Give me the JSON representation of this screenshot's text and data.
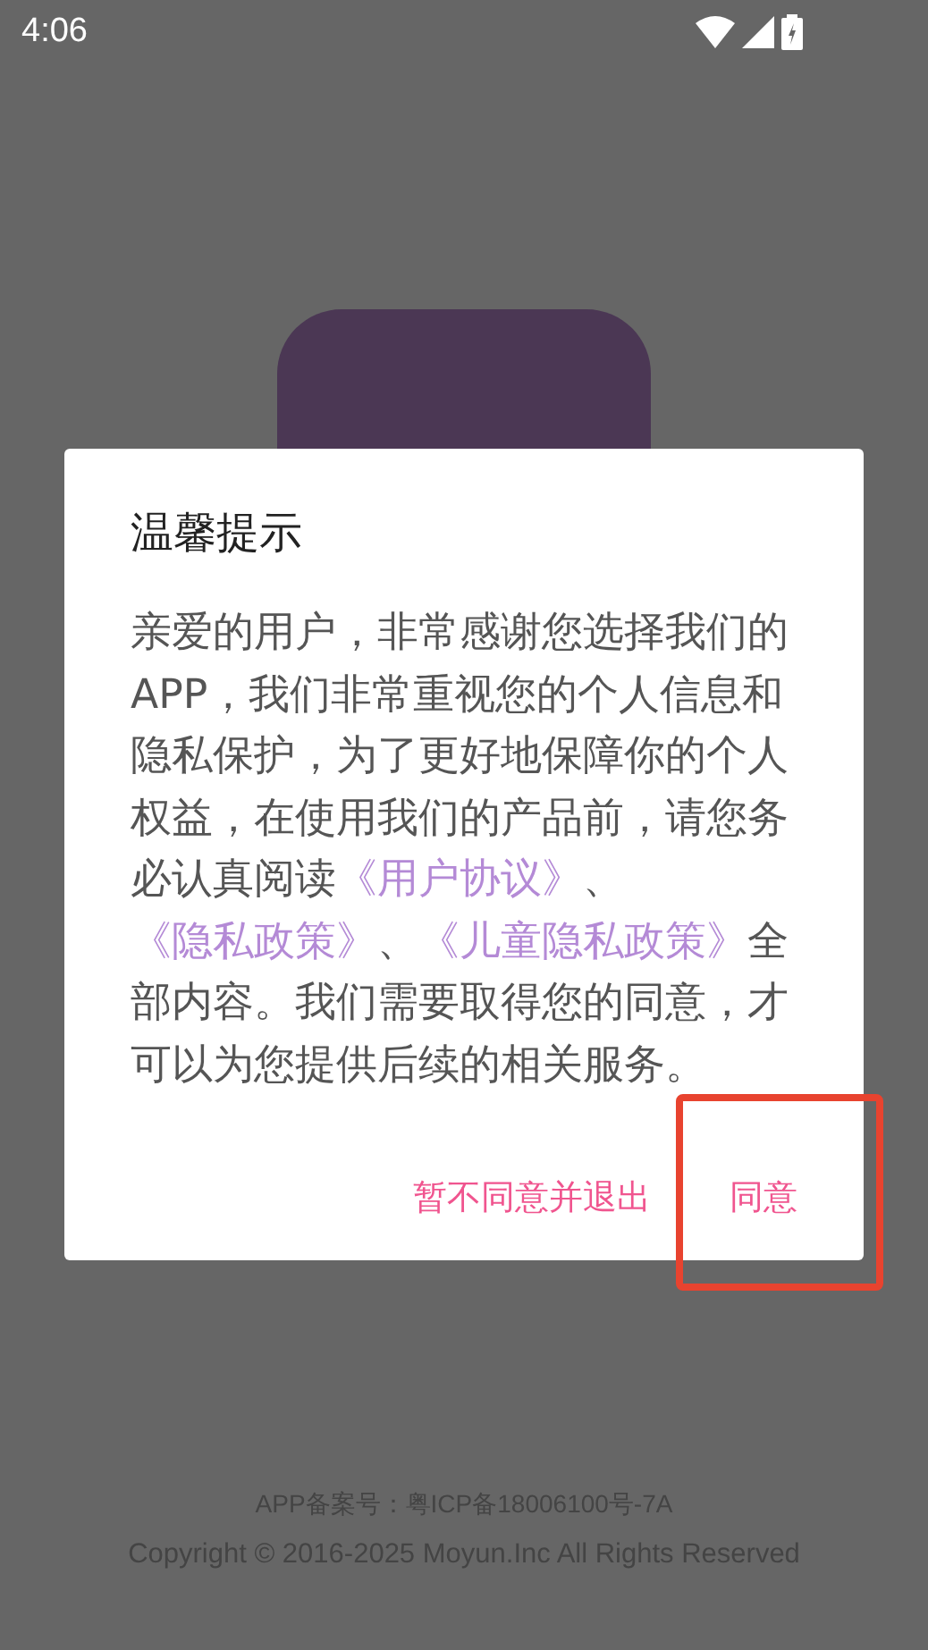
{
  "status_bar": {
    "time": "4:06"
  },
  "dialog": {
    "title": "温馨提示",
    "body": [
      {
        "kind": "text",
        "text": "亲爱的用户，非常感谢您选择我们的APP，我们非常重视您的个人信息和隐私保护，为了更好地保障你的个人权益，在使用我们的产品前，请您务必认真阅读"
      },
      {
        "kind": "link",
        "text": "《用户协议》"
      },
      {
        "kind": "text",
        "text": "、"
      },
      {
        "kind": "link",
        "text": "《隐私政策》"
      },
      {
        "kind": "text",
        "text": "、"
      },
      {
        "kind": "link",
        "text": "《儿童隐私政策》"
      },
      {
        "kind": "text",
        "text": "全部内容。我们需要取得您的同意，才可以为您提供后续的相关服务。"
      }
    ],
    "buttons": [
      {
        "label": "暂不同意并退出"
      },
      {
        "label": "同意",
        "highlighted": true
      }
    ]
  },
  "footer": {
    "record": "APP备案号：粤ICP备18006100号-7A",
    "copyright": "Copyright © 2016-2025 Moyun.Inc All Rights Reserved"
  }
}
